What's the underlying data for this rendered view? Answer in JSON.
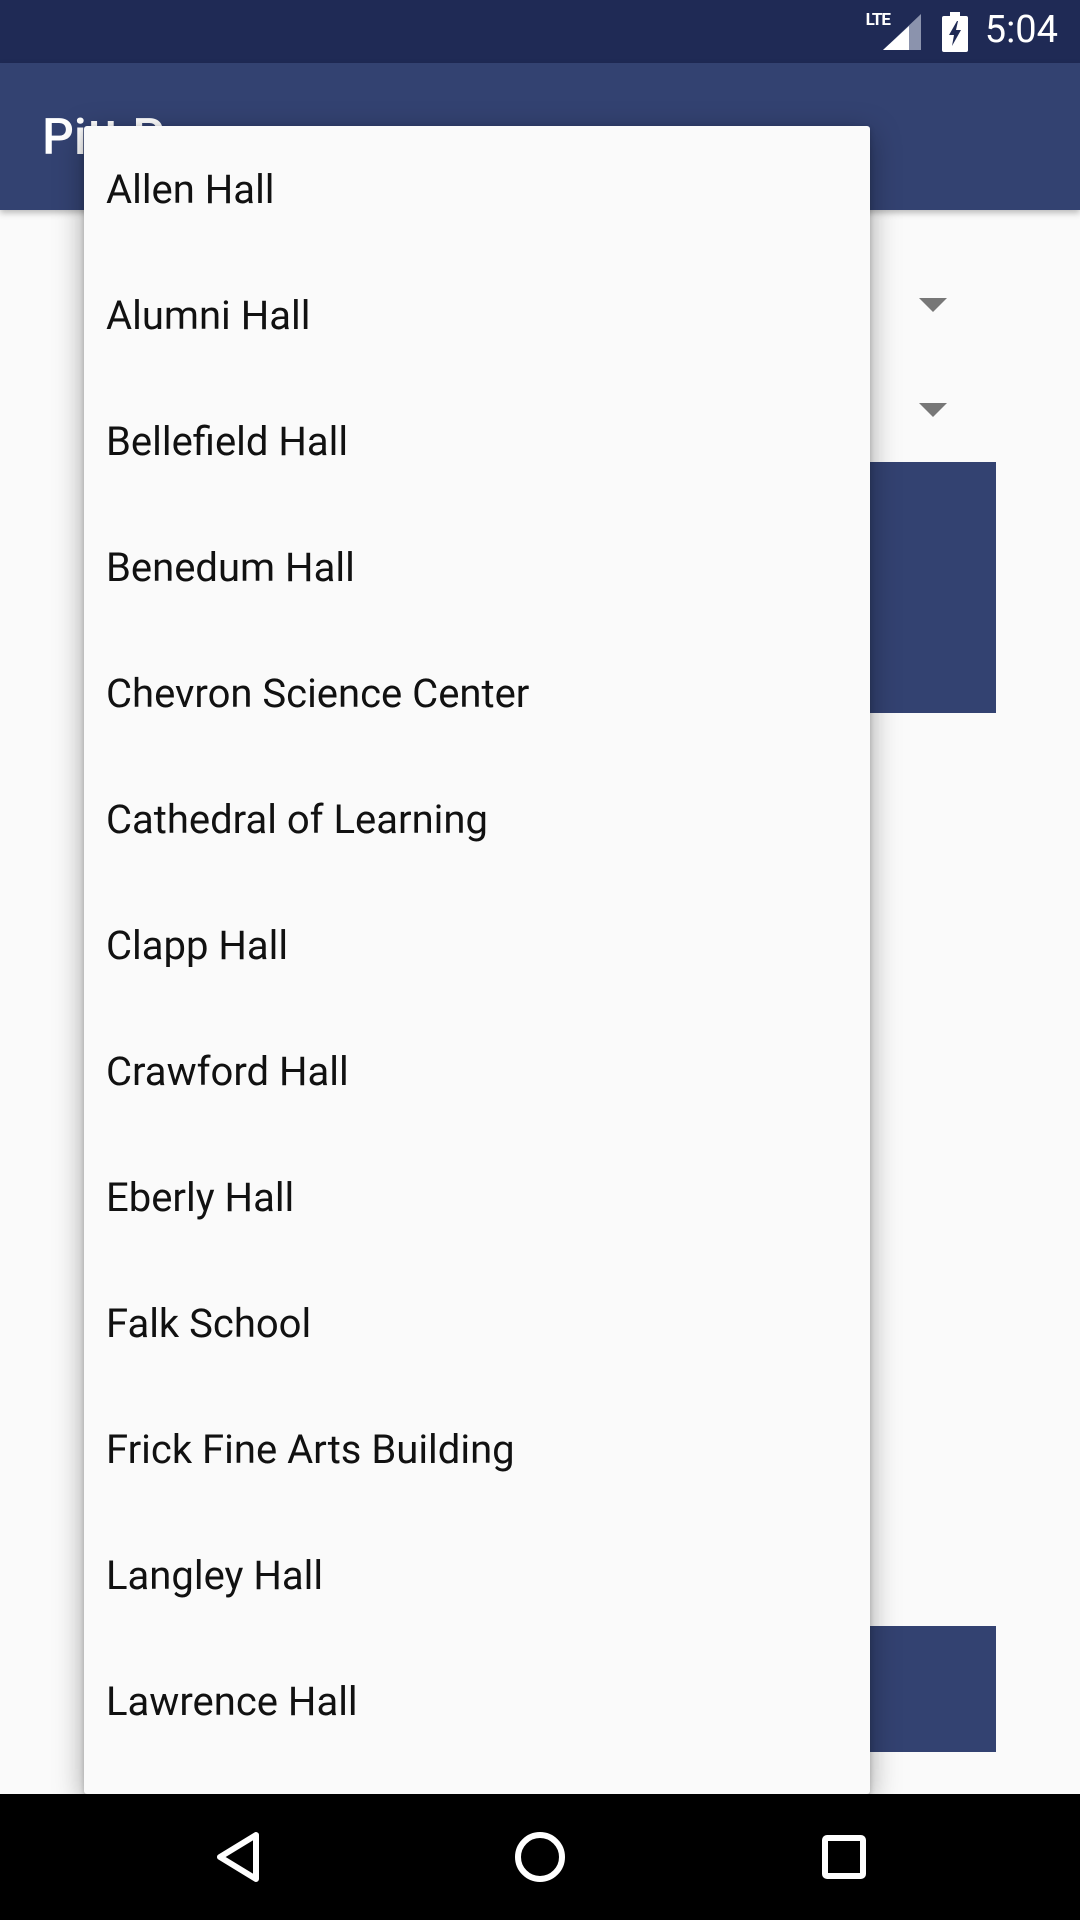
{
  "status_bar": {
    "network_label": "LTE",
    "time": "5:04",
    "icons": [
      "signal-icon",
      "battery-charging-icon"
    ]
  },
  "app_bar": {
    "title": "Pitt P"
  },
  "dropdown": {
    "items": [
      "Allen Hall",
      "Alumni Hall",
      "Bellefield Hall",
      "Benedum Hall",
      "Chevron Science Center",
      "Cathedral of Learning",
      "Clapp Hall",
      "Crawford Hall",
      "Eberly Hall",
      "Falk School",
      "Frick Fine Arts Building",
      "Langley Hall",
      "Lawrence Hall"
    ]
  },
  "nav_bar": {
    "icons": [
      "back-icon",
      "home-icon",
      "recent-apps-icon"
    ]
  },
  "colors": {
    "status_bar": "#1f2a55",
    "primary": "#334271",
    "background": "#fafafa",
    "nav_bar": "#000000"
  }
}
